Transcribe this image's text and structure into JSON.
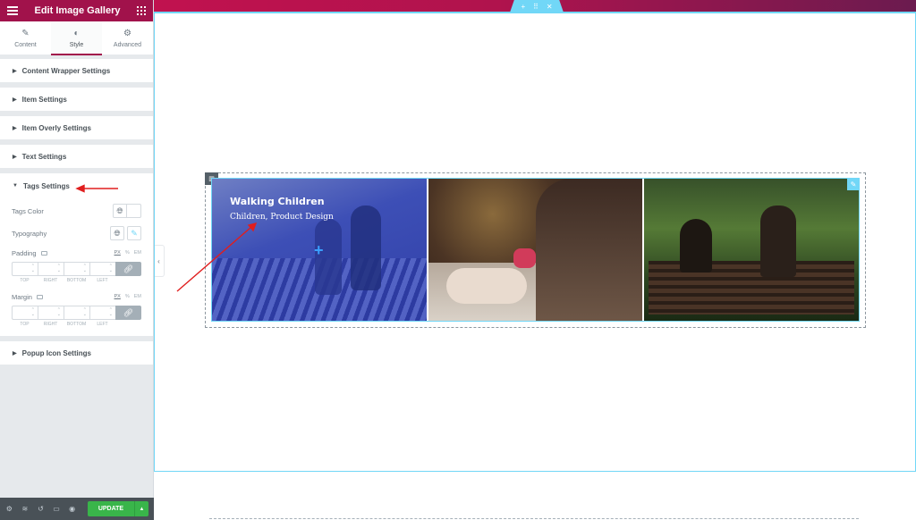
{
  "sidebar": {
    "title": "Edit Image Gallery",
    "tabs": [
      {
        "label": "Content",
        "icon": "pencil-icon",
        "glyph": "✎"
      },
      {
        "label": "Style",
        "icon": "contrast-icon",
        "glyph": "◐"
      },
      {
        "label": "Advanced",
        "icon": "gear-icon",
        "glyph": "⚙"
      }
    ],
    "sections": [
      {
        "label": "Content Wrapper Settings"
      },
      {
        "label": "Item Settings"
      },
      {
        "label": "Item Overly Settings"
      },
      {
        "label": "Text Settings"
      }
    ],
    "tags_section": {
      "label": "Tags Settings",
      "tags_color_label": "Tags Color",
      "typography_label": "Typography",
      "padding_label": "Padding",
      "margin_label": "Margin",
      "units": [
        "PX",
        "%",
        "EM"
      ],
      "dim_labels": [
        "TOP",
        "RIGHT",
        "BOTTOM",
        "LEFT"
      ]
    },
    "popup_section": {
      "label": "Popup Icon Settings"
    },
    "update_label": "UPDATE"
  },
  "gallery": {
    "items": [
      {
        "title": "Walking Children",
        "tags": "Children, Product Design"
      }
    ]
  },
  "colors": {
    "brand": "#a1124b",
    "accent": "#71d7f7",
    "update": "#39b54a"
  }
}
